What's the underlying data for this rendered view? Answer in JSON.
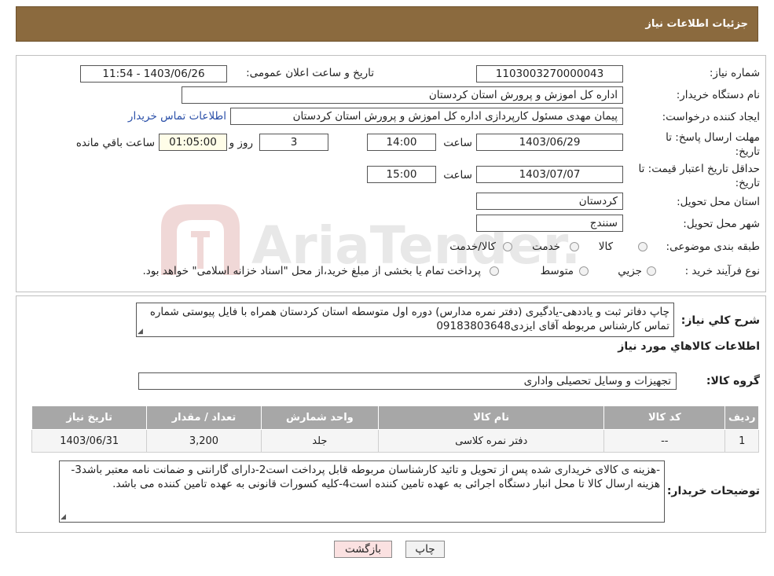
{
  "header": {
    "title": "جزئیات اطلاعات نیاز"
  },
  "form": {
    "need_number_label": "شماره نیاز:",
    "need_number": "1103003270000043",
    "announce_label": "تاریخ و ساعت اعلان عمومی:",
    "announce_value": "1403/06/26 - 11:54",
    "buyer_org_label": "نام دستگاه خریدار:",
    "buyer_org": "اداره کل اموزش و پرورش استان کردستان",
    "creator_label": "ایجاد کننده درخواست:",
    "creator": "پیمان مهدی مسئول کارپردازی اداره کل اموزش و پرورش استان کردستان",
    "contact_link": "اطلاعات تماس خریدار",
    "deadline_label": "مهلت ارسال پاسخ: تا تاریخ:",
    "deadline_date": "1403/06/29",
    "time_label": "ساعت",
    "deadline_time": "14:00",
    "days_value": "3",
    "days_label": "روز و",
    "remaining_time": "01:05:00",
    "remaining_label": "ساعت باقي مانده",
    "validity_label": "حداقل تاریخ اعتبار قیمت: تا تاریخ:",
    "validity_date": "1403/07/07",
    "validity_time": "15:00",
    "province_label": "استان محل تحویل:",
    "province": "کردستان",
    "city_label": "شهر محل تحویل:",
    "city": "سنندج",
    "category_label": "طبقه بندی موضوعی:",
    "category_options": [
      "کالا",
      "خدمت",
      "کالا/خدمت"
    ],
    "purchase_type_label": "نوع فرآیند خرید :",
    "purchase_options": [
      "جزیي",
      "متوسط"
    ],
    "purchase_note": "پرداخت تمام یا بخشی از مبلغ خرید،از محل \"اسناد خزانه اسلامی\" خواهد بود."
  },
  "summary": {
    "label": "شرح کلي نياز:",
    "text": "چاپ دفاتر ثبت و یاددهی-یادگیری (دفتر نمره مدارس) دوره اول متوسطه استان کردستان همراه با فایل پیوستی شماره تماس کارشناس مربوطه آقای ایزدی09183803648"
  },
  "goods": {
    "section_title": "اطلاعات کالاهاي مورد نياز",
    "group_label": "گروه کالا:",
    "group_value": "تجهیزات و وسایل تحصیلی واداری",
    "table": {
      "headers": [
        "ردیف",
        "کد کالا",
        "نام کالا",
        "واحد شمارش",
        "تعداد / مقدار",
        "تاریخ نیاز"
      ],
      "rows": [
        [
          "1",
          "--",
          "دفتر نمره کلاسی",
          "جلد",
          "3,200",
          "1403/06/31"
        ]
      ]
    }
  },
  "buyer_notes": {
    "label": "توضیحات خریدار:",
    "text": "-هزینه ی کالای خریداری شده پس از تحویل و تائید کارشناسان مربوطه قابل پرداخت است2-دارای گارانتی و ضمانت نامه معتبر باشد3- هزینه ارسال کالا تا محل انبار دستگاه اجرائی به عهده تامین کننده است4-کلیه کسورات قانونی به عهده تامین کننده می باشد."
  },
  "buttons": {
    "print": "چاپ",
    "back": "بازگشت"
  },
  "watermark": {
    "text": "AriaTender.neT"
  },
  "colors": {
    "header_bg": "#8b6a3e",
    "link": "#2a4fa8",
    "table_header": "#a7a7a7",
    "back_button": "#fbe1e1"
  }
}
